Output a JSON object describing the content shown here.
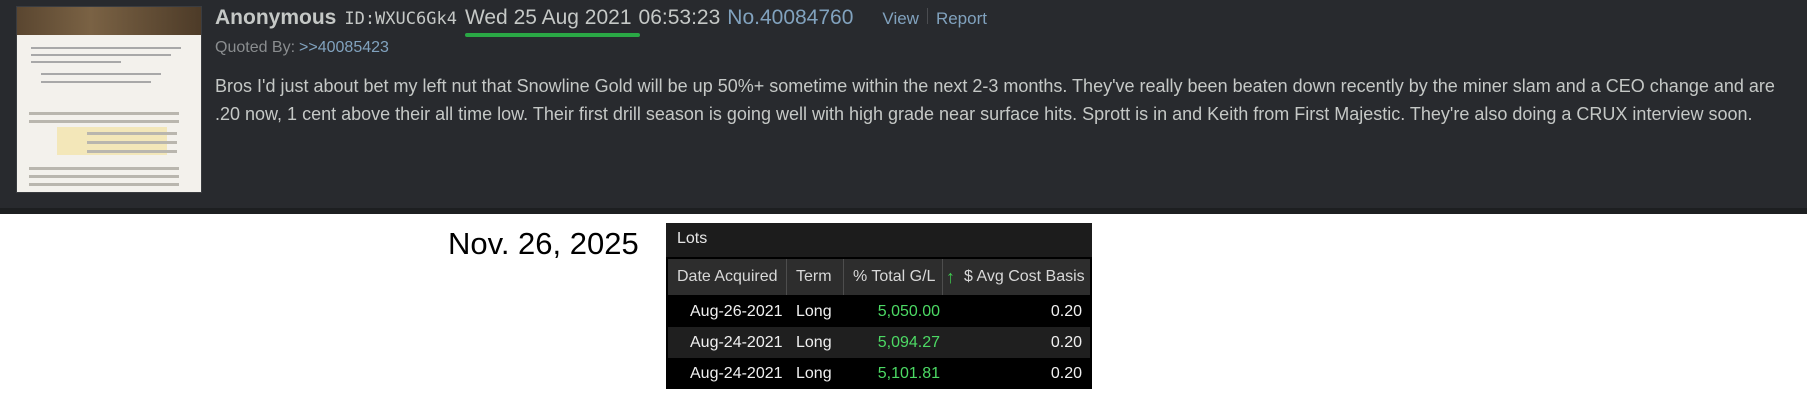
{
  "post": {
    "name": "Anonymous",
    "poster_id": "ID:WXUC6Gk4",
    "date": "Wed 25 Aug 2021",
    "time": "06:53:23",
    "post_number": "No.40084760",
    "view_label": "View",
    "report_label": "Report",
    "quoted_by_label": "Quoted By:",
    "quoted_by_link": ">>40085423",
    "body": "Bros I'd just about bet my left nut that Snowline Gold will be up 50%+ sometime within the next 2-3 months. They've really been beaten down recently by the miner slam and a CEO change and are .20 now, 1 cent above their all time low. Their first drill season is going well with high grade near surface hits. Sprott is in and Keith from First Majestic. They're also doing a CRUX interview soon.",
    "highlight_color": "#2aa845"
  },
  "caption": "Nov. 26, 2025",
  "lots": {
    "title": "Lots",
    "columns": [
      "Date Acquired",
      "Term",
      "% Total G/L",
      "$ Avg Cost Basis"
    ],
    "sort_icon": "up-arrow-icon",
    "gain_color": "#4cd964",
    "rows": [
      {
        "date": "Aug-26-2021",
        "term": "Long",
        "gl": "5,050.00",
        "cost": "0.20"
      },
      {
        "date": "Aug-24-2021",
        "term": "Long",
        "gl": "5,094.27",
        "cost": "0.20"
      },
      {
        "date": "Aug-24-2021",
        "term": "Long",
        "gl": "5,101.81",
        "cost": "0.20"
      }
    ]
  }
}
